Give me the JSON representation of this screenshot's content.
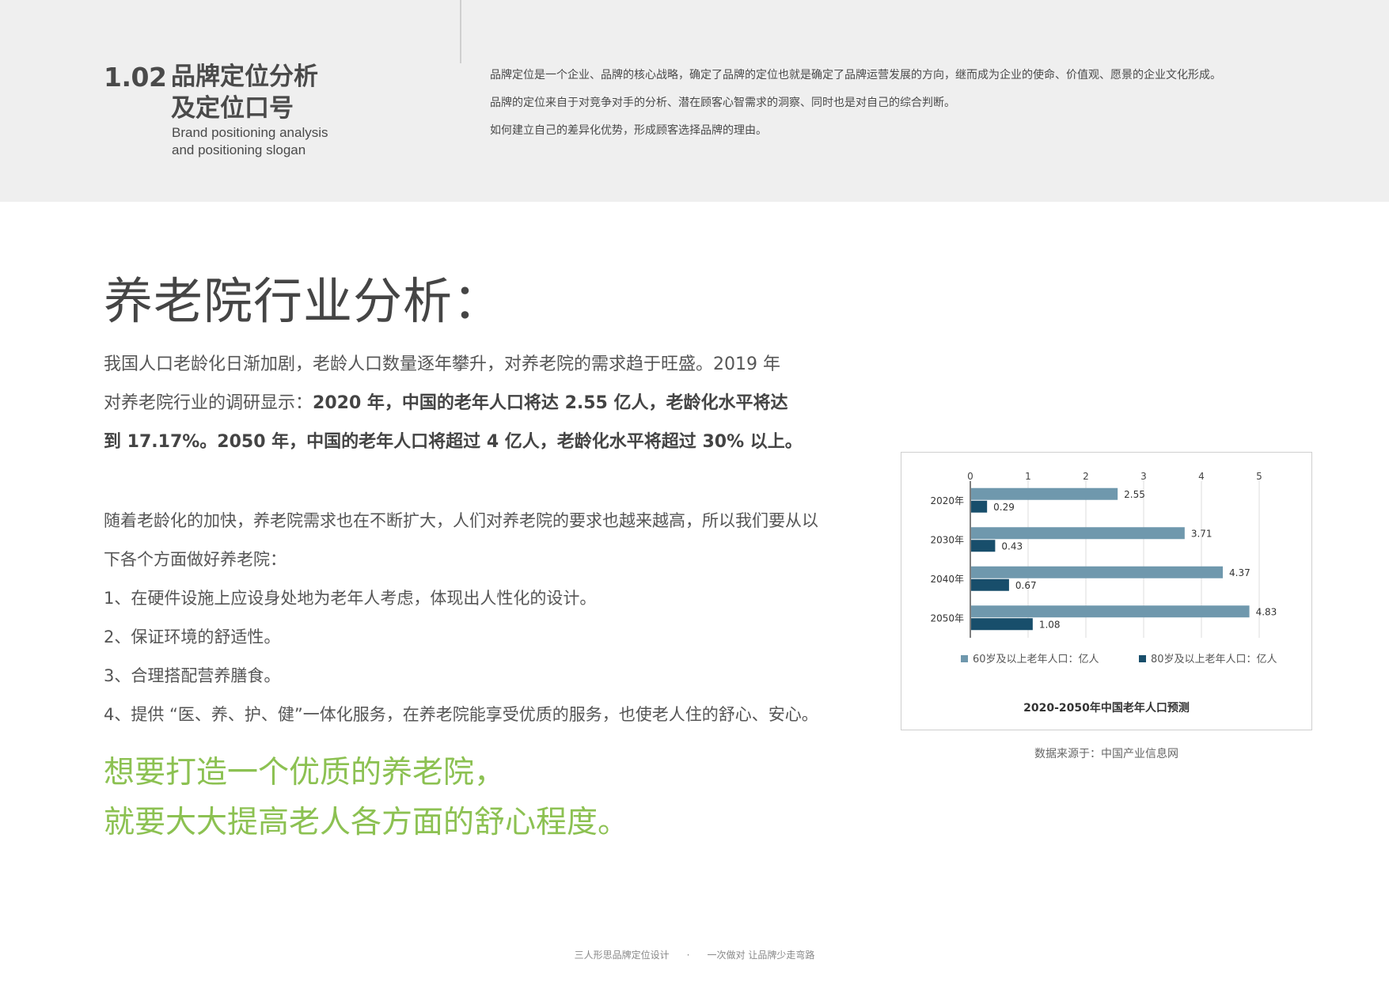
{
  "header": {
    "section_number": "1.02",
    "title_line1": "品牌定位分析",
    "title_line2": "及定位口号",
    "subtitle_en_line1": "Brand positioning analysis",
    "subtitle_en_line2": "and positioning slogan",
    "intro": [
      "品牌定位是一个企业、品牌的核心战略，确定了品牌的定位也就是确定了品牌运营发展的方向，继而成为企业的使命、价值观、愿景的企业文化形成。",
      "品牌的定位来自于对竞争对手的分析、潜在顾客心智需求的洞察、同时也是对自己的综合判断。",
      "如何建立自己的差异化优势，形成顾客选择品牌的理由。"
    ]
  },
  "main": {
    "heading": "养老院行业分析：",
    "para1_line1": "我国人口老龄化日渐加剧，老龄人口数量逐年攀升，对养老院的需求趋于旺盛。2019 年",
    "para1_line2_normal": "对养老院行业的调研显示：",
    "para1_line2_bold": "2020 年，中国的老年人口将达 2.55 亿人，老龄化水平将达",
    "para1_line3_bold": "到 17.17%。2050 年，中国的老年人口将超过 4 亿人，老龄化水平将超过 30% 以上。",
    "para2_line1": "随着老龄化的加快，养老院需求也在不断扩大，人们对养老院的要求也越来越高，所以我们要从以",
    "para2_line2": "下各个方面做好养老院：",
    "list": [
      "1、在硬件设施上应设身处地为老年人考虑，体现出人性化的设计。",
      "2、保证环境的舒适性。",
      "3、合理搭配营养膳食。",
      "4、提供 “医、养、护、健”一体化服务，在养老院能享受优质的服务，也使老人住的舒心、安心。"
    ],
    "slogan_line1": "想要打造一个优质的养老院，",
    "slogan_line2": "就要大大提高老人各方面的舒心程度。"
  },
  "chart_data": {
    "type": "bar",
    "orientation": "horizontal",
    "title": "2020-2050年中国老年人口预测",
    "categories": [
      "2020年",
      "2030年",
      "2040年",
      "2050年"
    ],
    "series": [
      {
        "name": "60岁及以上老年人口：亿人",
        "values": [
          2.55,
          3.71,
          4.37,
          4.83
        ],
        "color": "#6f98ad"
      },
      {
        "name": "80岁及以上老年人口：亿人",
        "values": [
          0.29,
          0.43,
          0.67,
          1.08
        ],
        "color": "#184e6b"
      }
    ],
    "x_ticks": [
      "0",
      "1",
      "2",
      "3",
      "4",
      "5"
    ],
    "xlim": [
      0,
      5.5
    ],
    "grid": true,
    "legend_position": "bottom",
    "axis_position": "top"
  },
  "chart_source": "数据来源于：中国产业信息网",
  "footer": {
    "left": "三人形思品牌定位设计",
    "sep": "·",
    "right": "一次做对 让品牌少走弯路"
  }
}
